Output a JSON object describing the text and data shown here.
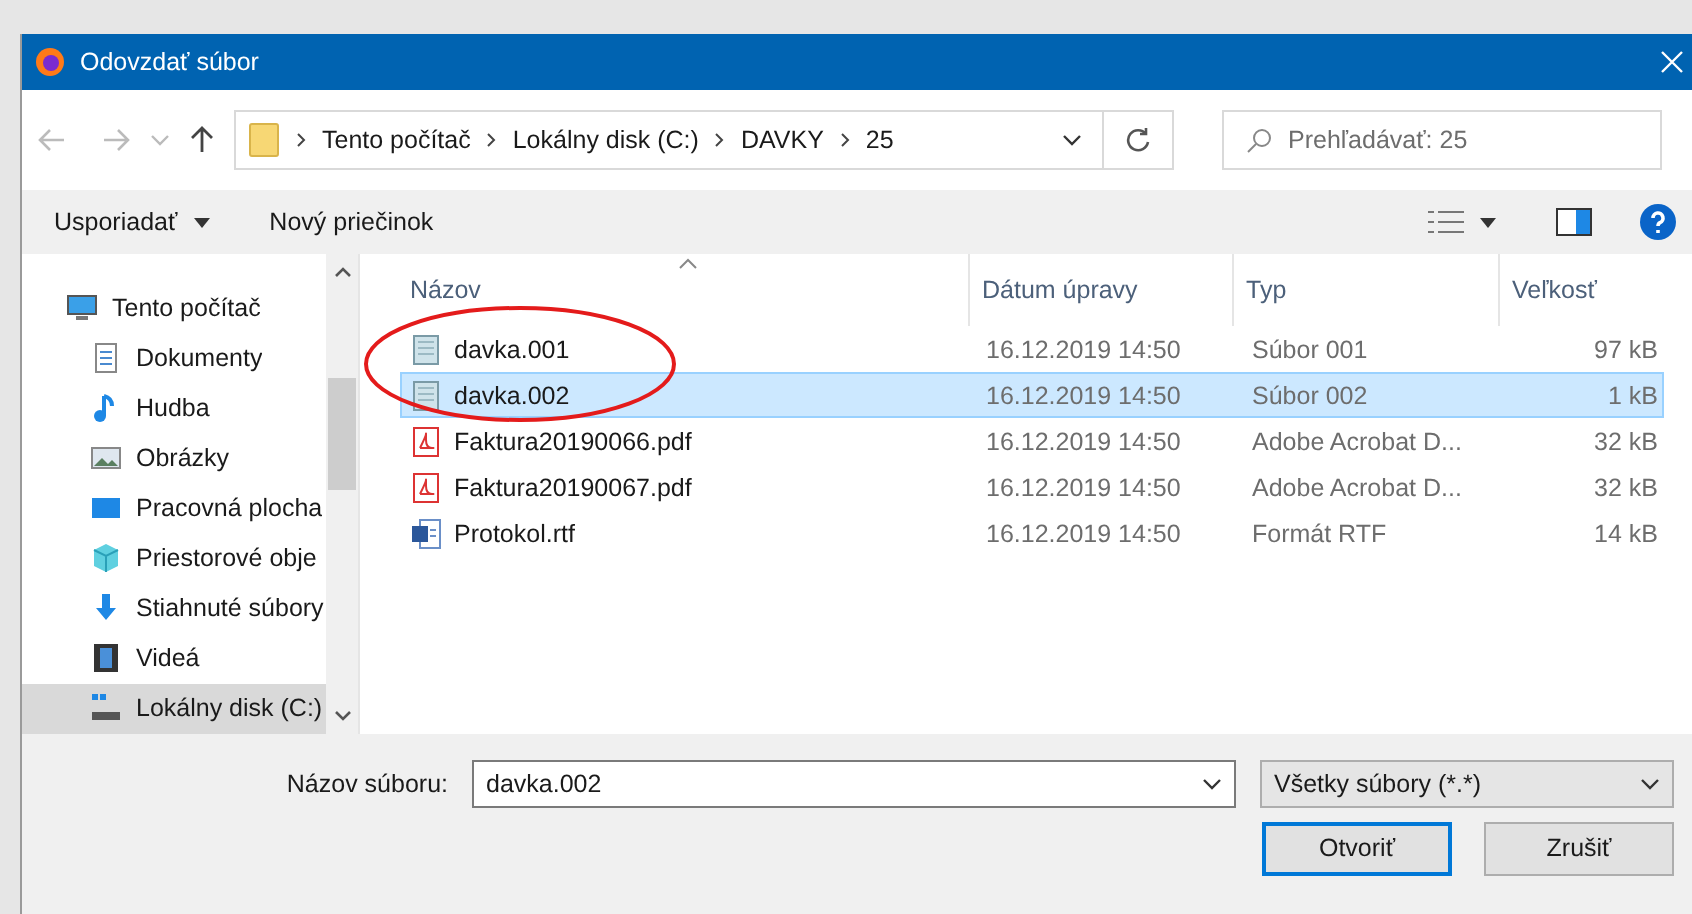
{
  "window": {
    "title": "Odovzdať súbor"
  },
  "address": {
    "crumbs": [
      "Tento počítač",
      "Lokálny disk (C:)",
      "DAVKY",
      "25"
    ]
  },
  "search": {
    "placeholder": "Prehľadávať: 25"
  },
  "toolbar": {
    "organize": "Usporiadať",
    "new_folder": "Nový priečinok"
  },
  "sidebar": {
    "items": [
      {
        "label": "Tento počítač",
        "kind": "computer",
        "selected": false,
        "children": [
          {
            "label": "Dokumenty",
            "kind": "documents",
            "selected": false
          },
          {
            "label": "Hudba",
            "kind": "music",
            "selected": false
          },
          {
            "label": "Obrázky",
            "kind": "pictures",
            "selected": false
          },
          {
            "label": "Pracovná plocha",
            "kind": "desktop",
            "selected": false
          },
          {
            "label": "Priestorové obje",
            "kind": "objects",
            "selected": false
          },
          {
            "label": "Stiahnuté súbory",
            "kind": "downloads",
            "selected": false
          },
          {
            "label": "Videá",
            "kind": "videos",
            "selected": false
          },
          {
            "label": "Lokálny disk (C:)",
            "kind": "disk",
            "selected": true
          }
        ]
      }
    ]
  },
  "table": {
    "columns": [
      {
        "label": "Názov",
        "sorted": true
      },
      {
        "label": "Dátum úpravy"
      },
      {
        "label": "Typ"
      },
      {
        "label": "Veľkosť"
      }
    ],
    "rows": [
      {
        "name": "davka.001",
        "kind": "text",
        "date": "16.12.2019 14:50",
        "type": "Súbor 001",
        "size": "97 kB",
        "selected": false
      },
      {
        "name": "davka.002",
        "kind": "text",
        "date": "16.12.2019 14:50",
        "type": "Súbor 002",
        "size": "1 kB",
        "selected": true
      },
      {
        "name": "Faktura20190066.pdf",
        "kind": "pdf",
        "date": "16.12.2019 14:50",
        "type": "Adobe Acrobat D...",
        "size": "32 kB",
        "selected": false
      },
      {
        "name": "Faktura20190067.pdf",
        "kind": "pdf",
        "date": "16.12.2019 14:50",
        "type": "Adobe Acrobat D...",
        "size": "32 kB",
        "selected": false
      },
      {
        "name": "Protokol.rtf",
        "kind": "rtf",
        "date": "16.12.2019 14:50",
        "type": "Formát RTF",
        "size": "14 kB",
        "selected": false
      }
    ]
  },
  "annotations": [
    {
      "kind": "ellipse"
    }
  ],
  "footer": {
    "filename_label": "Názov súboru:",
    "filename": "davka.002",
    "filter": "Všetky súbory (*.*)",
    "buttons": [
      {
        "label": "Otvoriť",
        "selected": true
      },
      {
        "label": "Zrušiť",
        "selected": false
      }
    ]
  }
}
